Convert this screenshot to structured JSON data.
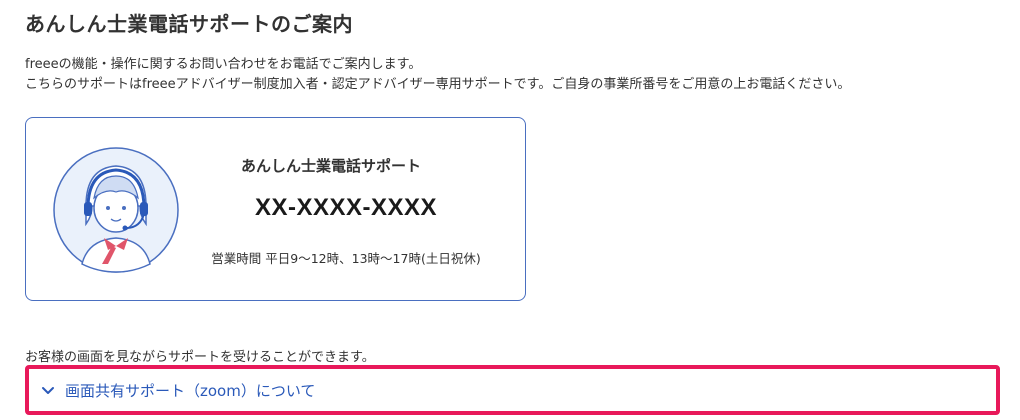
{
  "header": {
    "title": "あんしん士業電話サポートのご案内"
  },
  "intro": {
    "line1": "freeeの機能・操作に関するお問い合わせをお電話でご案内します。",
    "line2": "こちらのサポートはfreeeアドバイザー制度加入者・認定アドバイザー専用サポートです。ご自身の事業所番号をご用意の上お電話ください。"
  },
  "support_card": {
    "title": "あんしん士業電話サポート",
    "phone": "XX-XXXX-XXXX",
    "hours": "営業時間 平日9〜12時、13時〜17時(土日祝休)",
    "avatar_icon": "support-operator-illustration"
  },
  "screenshare": {
    "note": "お客様の画面を見ながらサポートを受けることができます。",
    "accordion_label": "画面共有サポート（zoom）について",
    "accordion_icon": "chevron-down-icon"
  },
  "colors": {
    "accent_blue": "#2a59b9",
    "card_border": "#4a6fc0",
    "highlight": "#e8195a"
  }
}
